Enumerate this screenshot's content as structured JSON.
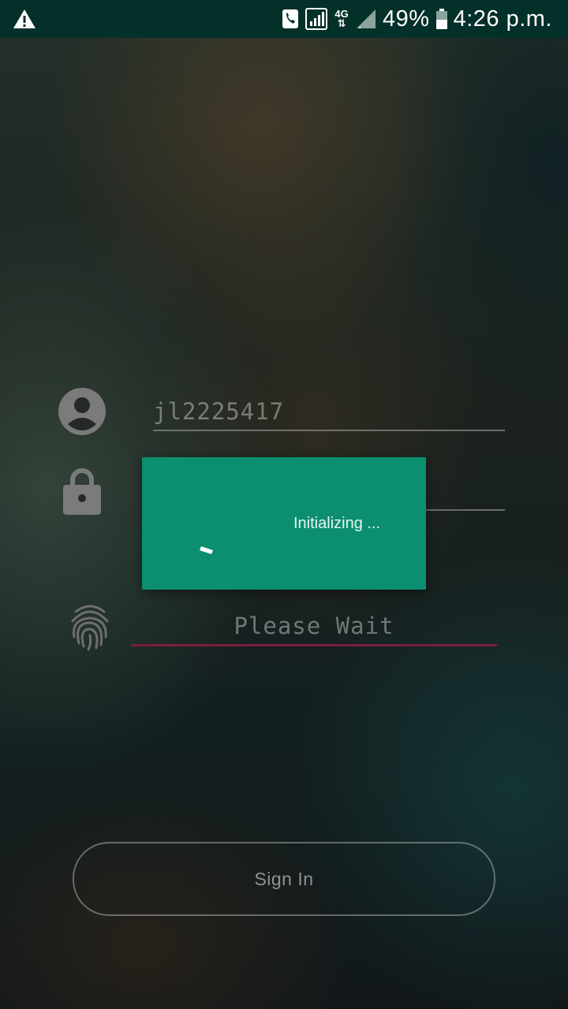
{
  "status_bar": {
    "battery": "49%",
    "time": "4:26 p.m.",
    "network_label": "4G",
    "icons": [
      "warning-icon",
      "phone-icon",
      "signal-icon",
      "network-4g-icon",
      "signal-empty-icon",
      "battery-icon"
    ]
  },
  "login": {
    "username_value": "jl2225417",
    "password_value": "",
    "fingerprint_prompt": "Please Wait",
    "sign_in_label": "Sign In"
  },
  "dialog": {
    "message": "Initializing ..."
  },
  "colors": {
    "status_bar": "#04302a",
    "dialog": "#0b8f70",
    "fingerprint_underline": "#7a1f3d"
  }
}
